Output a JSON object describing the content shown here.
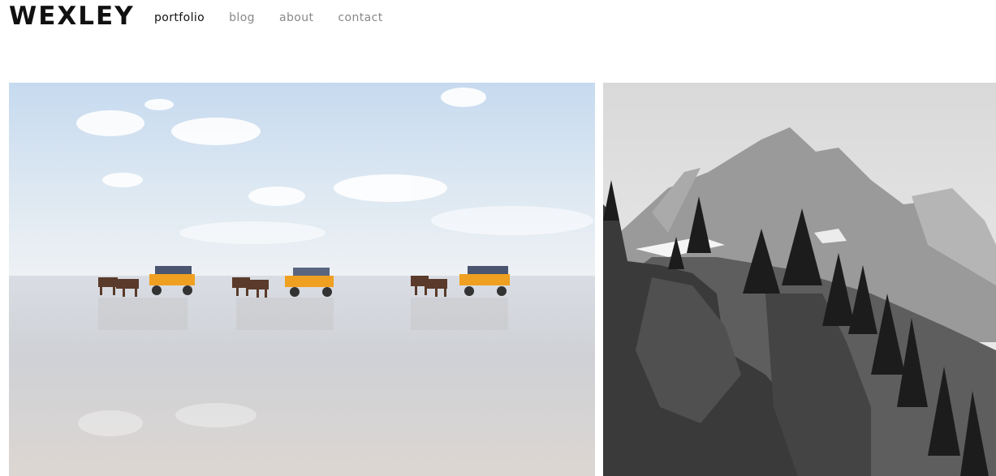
{
  "brand": {
    "logo_text": "WEXLEY"
  },
  "nav": {
    "items": [
      {
        "label": "portfolio",
        "active": true
      },
      {
        "label": "blog",
        "active": false
      },
      {
        "label": "about",
        "active": false
      },
      {
        "label": "contact",
        "active": false
      }
    ]
  },
  "gallery": {
    "tiles": [
      {
        "name": "horse-carriages-on-tidal-flat-photo",
        "tone": "color"
      },
      {
        "name": "mountain-cliff-black-and-white-photo",
        "tone": "monochrome"
      }
    ]
  },
  "colors": {
    "logo": "#111111",
    "nav_active": "#111111",
    "nav_inactive": "#888888",
    "carriage_yellow": "#f0a020",
    "sky_top": "#c9dcf0"
  }
}
